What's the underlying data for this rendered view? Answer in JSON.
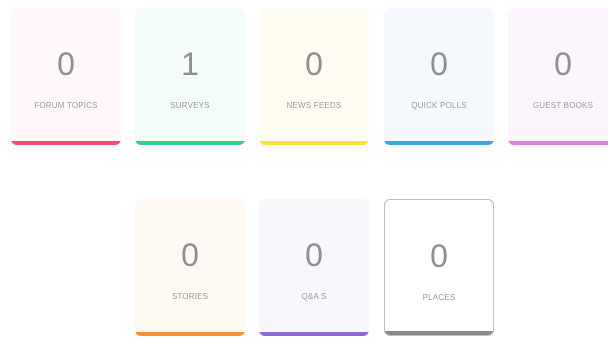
{
  "cards": [
    {
      "id": "c-forum",
      "count": "0",
      "label": "FORUM TOPICS",
      "bg": "#fff7f8",
      "bar": "#ef4f72"
    },
    {
      "id": "c-surveys",
      "count": "1",
      "label": "SURVEYS",
      "bg": "#f3fcf8",
      "bar": "#34cf8c"
    },
    {
      "id": "c-news",
      "count": "0",
      "label": "NEWS FEEDS",
      "bg": "#fffdf2",
      "bar": "#f3e33f"
    },
    {
      "id": "c-polls",
      "count": "0",
      "label": "QUICK POLLS",
      "bg": "#f5f9fe",
      "bar": "#3aa6ea"
    },
    {
      "id": "c-guest",
      "count": "0",
      "label": "GUEST BOOKS",
      "bg": "#fdf5fd",
      "bar": "#de7fdc"
    },
    {
      "id": "c-stories",
      "count": "0",
      "label": "STORIES",
      "bg": "#fff8f3",
      "bar": "#f6913a"
    },
    {
      "id": "c-qa",
      "count": "0",
      "label": "Q&A S",
      "bg": "#f8f7fc",
      "bar": "#8e6ad5"
    },
    {
      "id": "c-places",
      "count": "0",
      "label": "PLACES",
      "bg": "#ffffff",
      "bar": "#8a8a8a"
    }
  ]
}
